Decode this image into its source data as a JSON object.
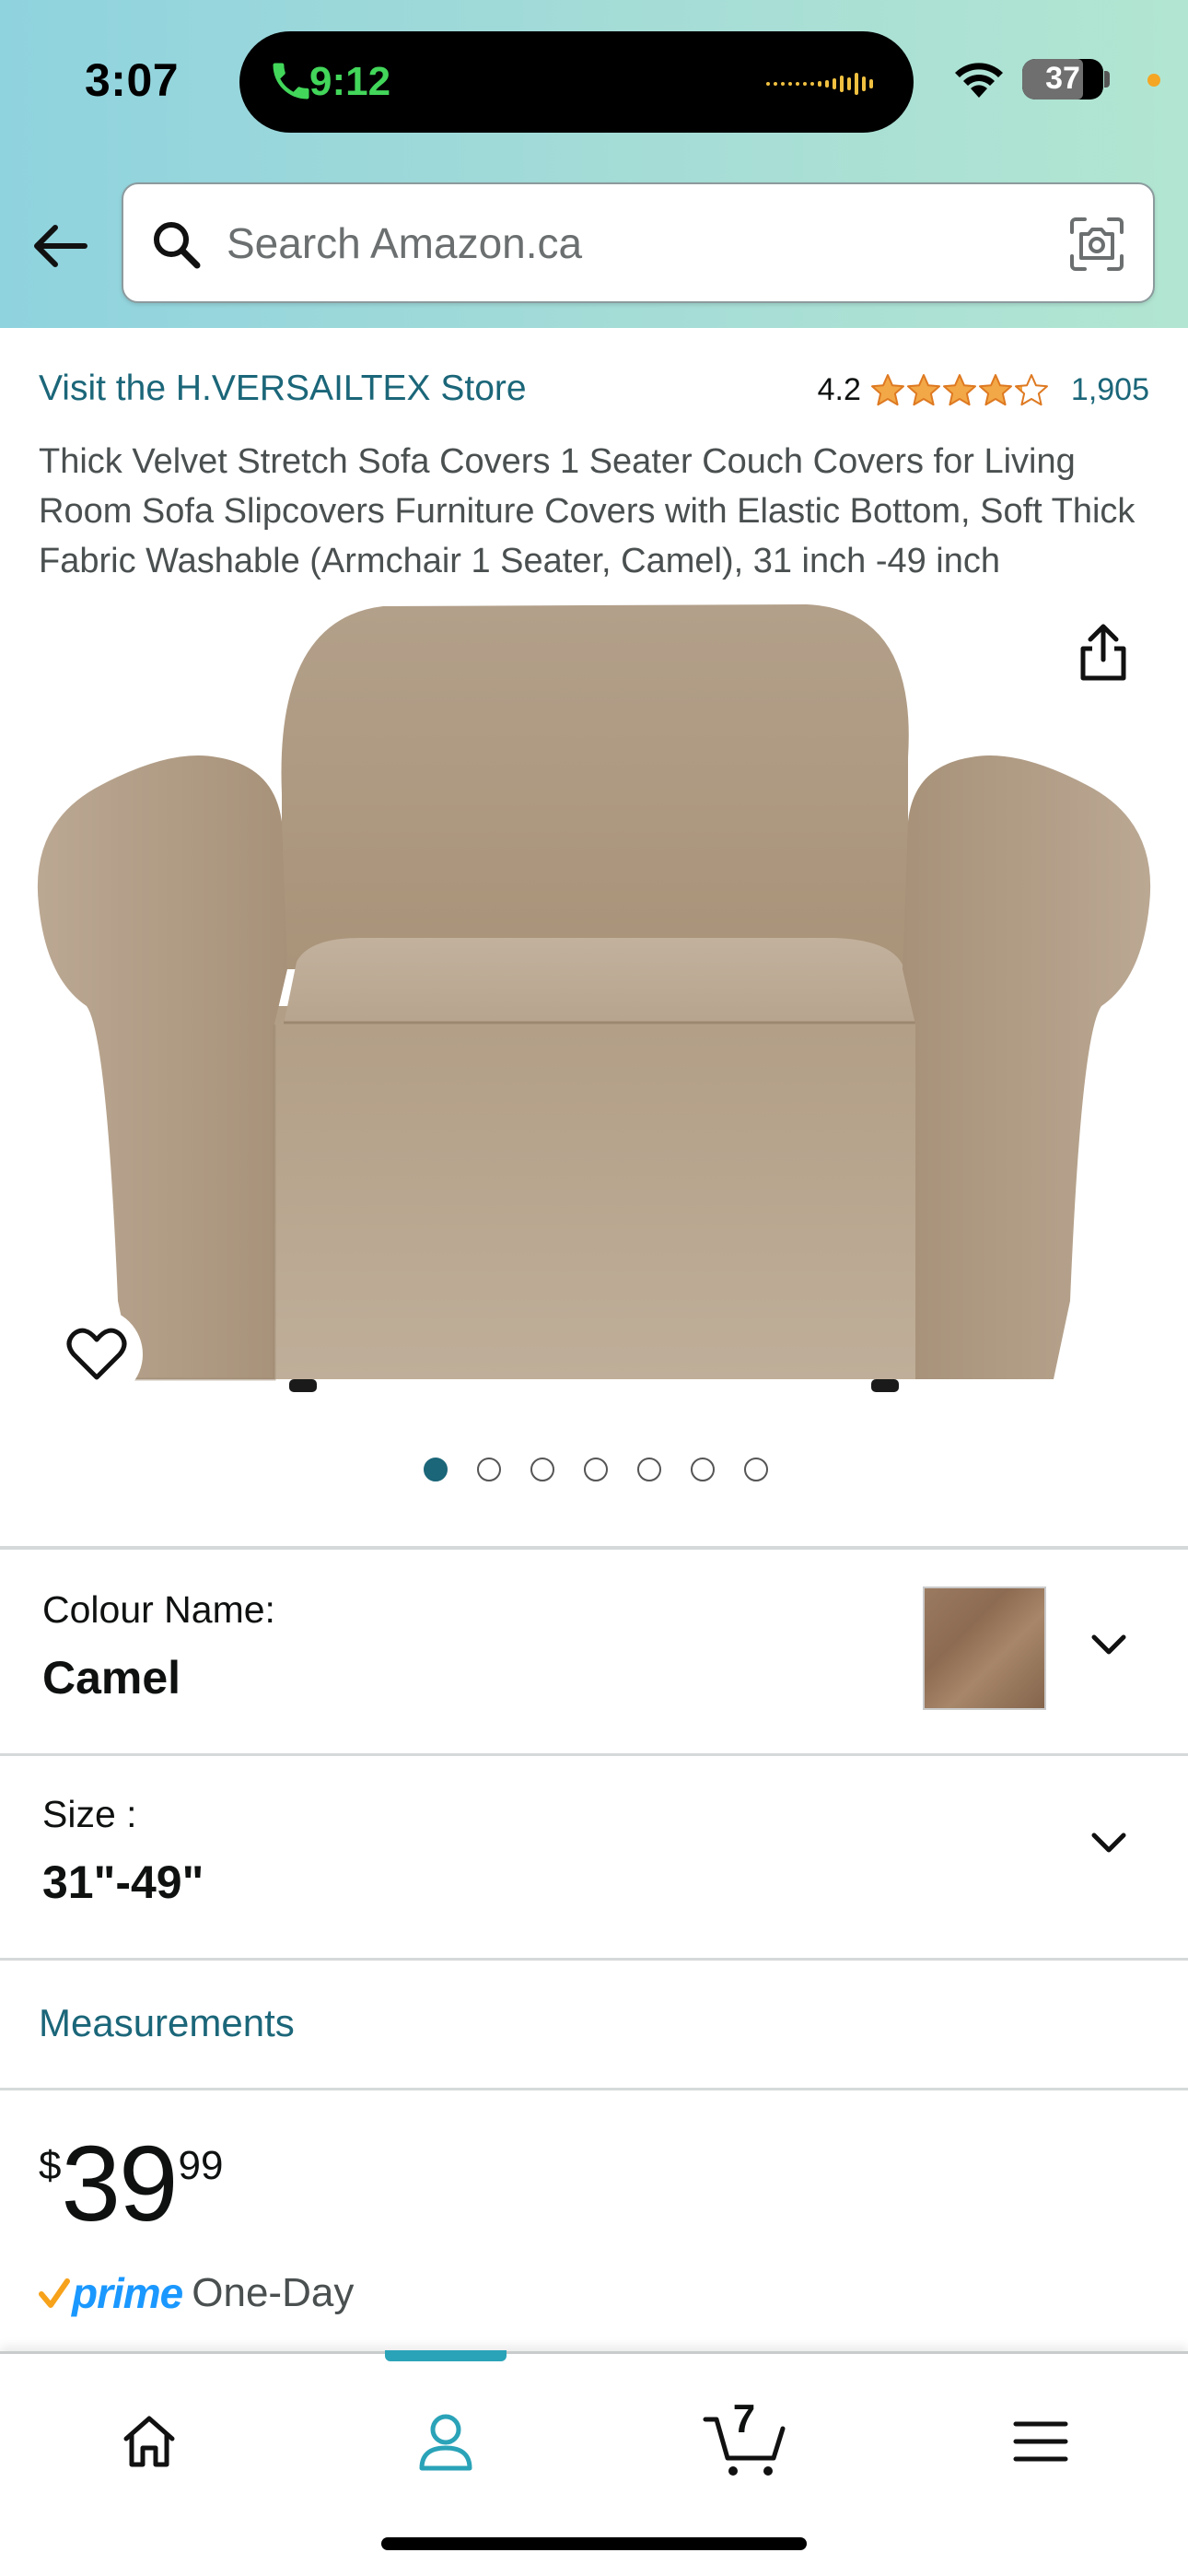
{
  "status_bar": {
    "time": "3:07",
    "call_time": "9:12",
    "battery": "37"
  },
  "search": {
    "placeholder": "Search Amazon.ca"
  },
  "product": {
    "store_link": "Visit the H.VERSAILTEX Store",
    "rating": "4.2",
    "rating_value": 4.2,
    "rating_max": 5,
    "review_count": "1,905",
    "title": "Thick Velvet Stretch Sofa Covers 1 Seater Couch Covers for Living Room Sofa Slipcovers Furniture Covers with Elastic Bottom, Soft Thick Fabric Washable (Armchair 1 Seater, Camel), 31 inch -49 inch",
    "image_count": 7,
    "active_image_index": 0
  },
  "variants": {
    "colour_label": "Colour Name:",
    "colour_value": "Camel",
    "size_label": "Size :",
    "size_value": "31\"-49\""
  },
  "measurements_link": "Measurements",
  "price": {
    "currency": "$",
    "whole": "39",
    "fraction": "99"
  },
  "delivery": {
    "prime": "prime",
    "speed": "One-Day"
  },
  "tabbar": {
    "cart_count": "7",
    "active_tab": "account"
  },
  "colors": {
    "link": "#1b6679",
    "star": "#f3a847",
    "prime_blue": "#1a98ff",
    "prime_check": "#f7a21b",
    "header_gradient_start": "#8fd3df",
    "header_gradient_end": "#b2e6d2",
    "active_tab_indicator": "#2aa3b8"
  },
  "icons": [
    "phone-icon",
    "audio-wave-icon",
    "wifi-icon",
    "battery-icon",
    "back-arrow-icon",
    "search-icon",
    "camera-lens-icon",
    "star-icon",
    "share-icon",
    "heart-icon",
    "chevron-down-icon",
    "home-icon",
    "account-icon",
    "cart-icon",
    "menu-icon"
  ]
}
